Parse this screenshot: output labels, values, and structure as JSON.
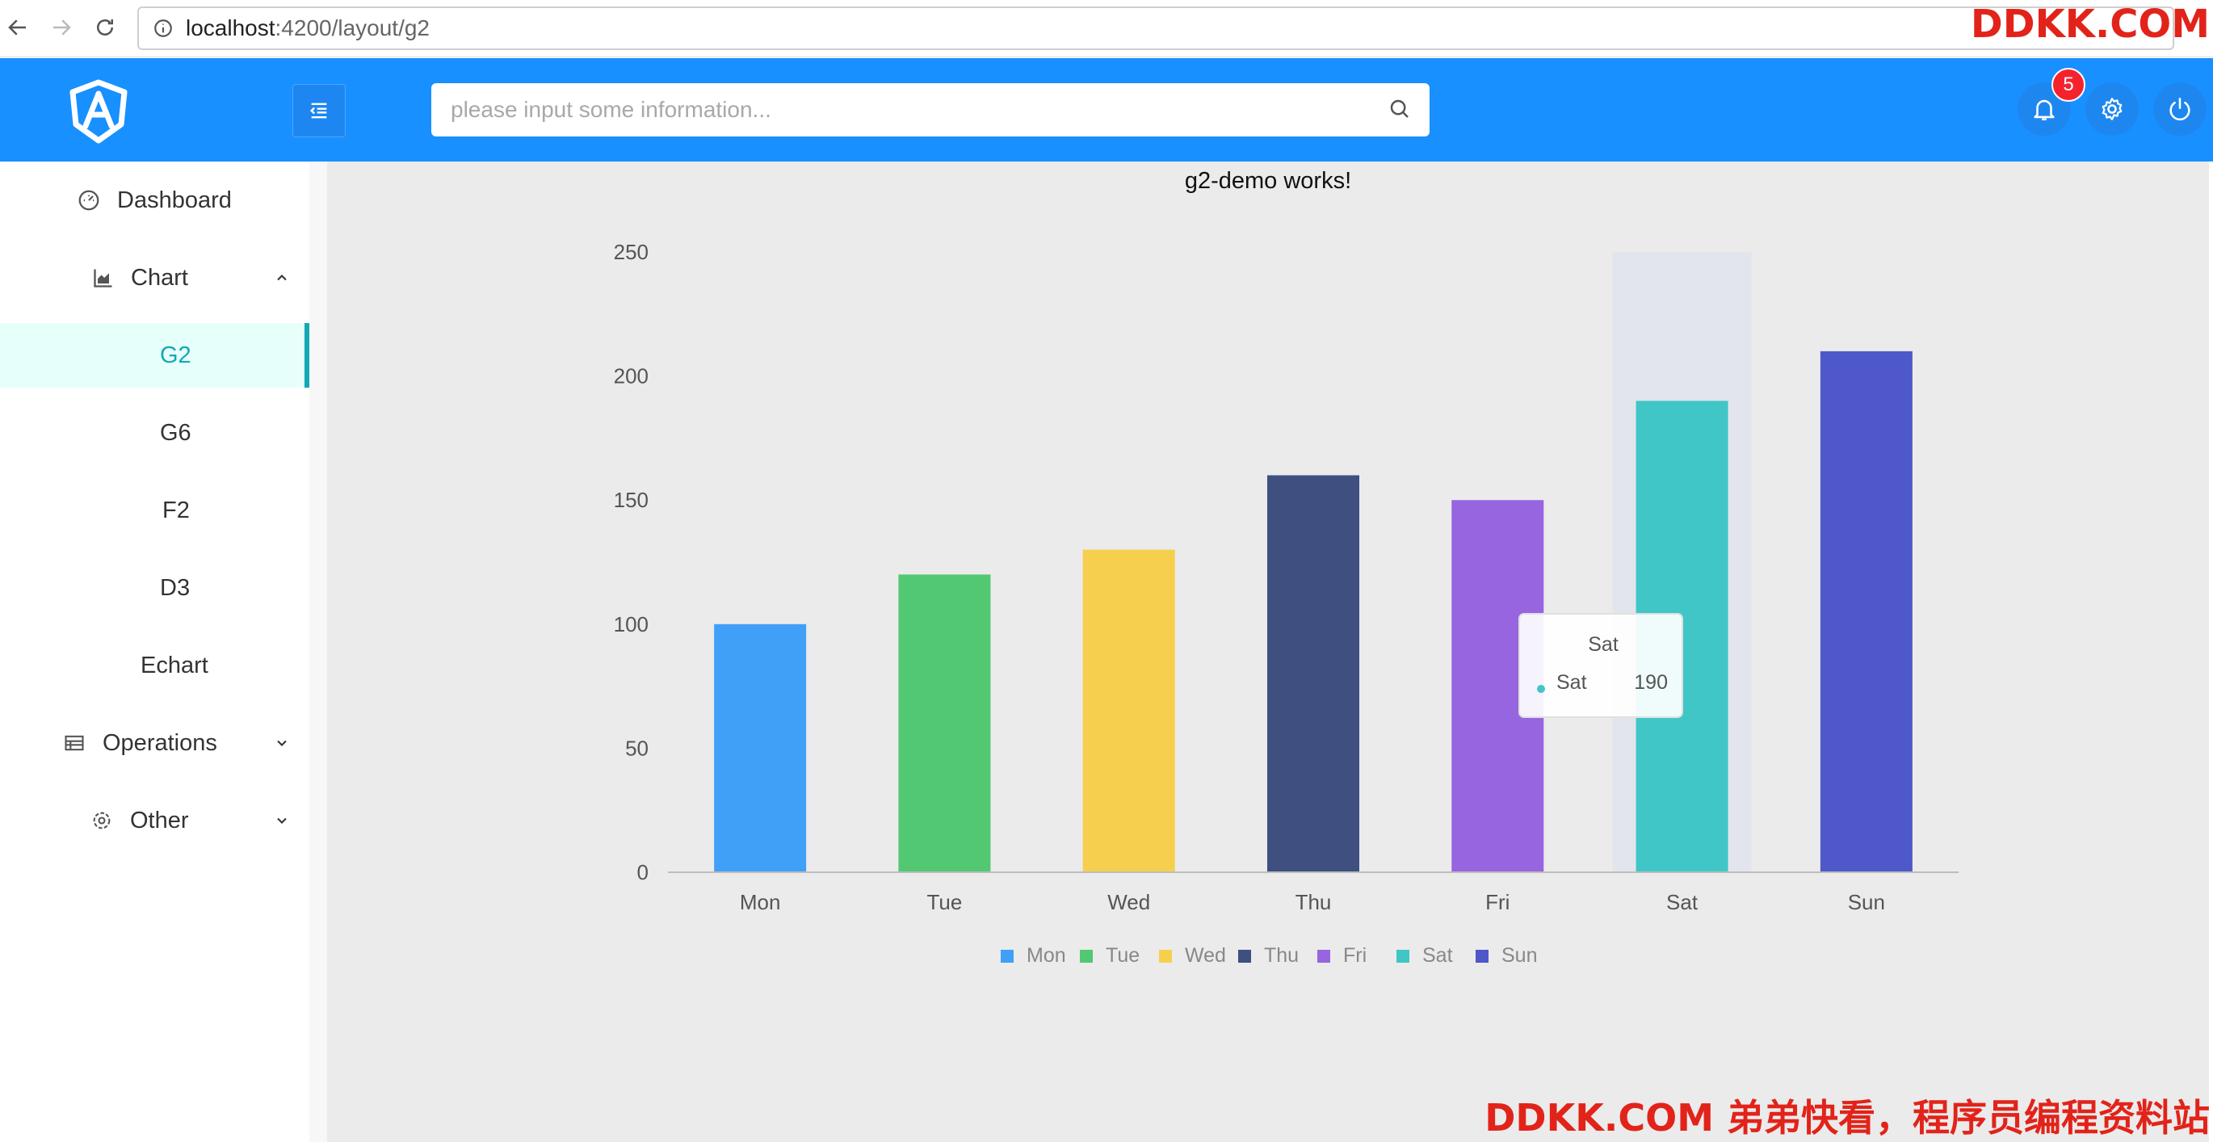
{
  "browser": {
    "url_host": "localhost",
    "url_path": ":4200/layout/g2"
  },
  "watermark": {
    "top": "DDKK.COM",
    "bottom": "DDKK.COM 弟弟快看，程序员编程资料站"
  },
  "header": {
    "search_placeholder": "please input some information...",
    "notification_count": "5"
  },
  "sidebar": {
    "items": [
      {
        "label": "Dashboard"
      },
      {
        "label": "Chart"
      },
      {
        "label": "G2"
      },
      {
        "label": "G6"
      },
      {
        "label": "F2"
      },
      {
        "label": "D3"
      },
      {
        "label": "Echart"
      },
      {
        "label": "Operations"
      },
      {
        "label": "Other"
      }
    ]
  },
  "main": {
    "title": "g2-demo works!"
  },
  "colors": {
    "header": "#1890ff",
    "selected": "#13a8b8",
    "badge": "#f5222d"
  },
  "chart_data": {
    "type": "bar",
    "categories": [
      "Mon",
      "Tue",
      "Wed",
      "Thu",
      "Fri",
      "Sat",
      "Sun"
    ],
    "values": [
      100,
      120,
      130,
      160,
      150,
      190,
      210
    ],
    "colors": [
      "#40a0f8",
      "#52c873",
      "#f6cf4f",
      "#3e4f80",
      "#9665df",
      "#40c6c6",
      "#4e58c8"
    ],
    "yticks": [
      0,
      50,
      100,
      150,
      200,
      250
    ],
    "ylim": [
      0,
      250
    ],
    "legend": [
      "Mon",
      "Tue",
      "Wed",
      "Thu",
      "Fri",
      "Sat",
      "Sun"
    ],
    "legend_position": "bottom",
    "tooltip": {
      "title": "Sat",
      "label": "Sat",
      "value": "190"
    }
  }
}
